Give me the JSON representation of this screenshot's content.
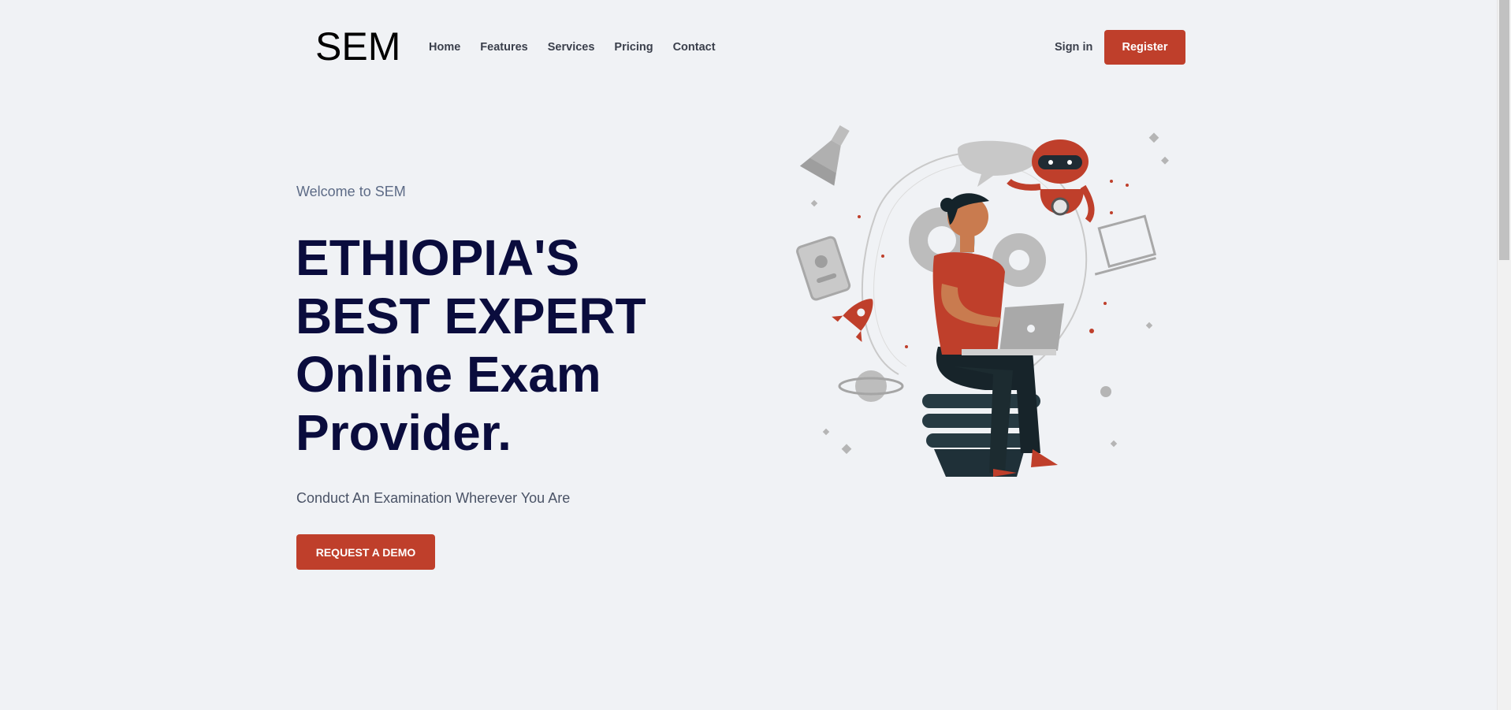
{
  "brand": {
    "logo_text": "SEM"
  },
  "nav": {
    "links": [
      "Home",
      "Features",
      "Services",
      "Pricing",
      "Contact"
    ],
    "sign_in": "Sign in",
    "register": "Register"
  },
  "hero": {
    "welcome": "Welcome to SEM",
    "headline_lines": [
      "ETHIOPIA'S",
      "BEST EXPERT",
      "Online Exam",
      "Provider."
    ],
    "subtitle": "Conduct An Examination Wherever You Are",
    "cta": "REQUEST A DEMO"
  },
  "illustration": {
    "icon": "woman-with-laptop-and-robot-illustration"
  },
  "colors": {
    "accent": "#bf3f2b",
    "heading": "#0a0c3d",
    "background": "#f0f2f5"
  }
}
